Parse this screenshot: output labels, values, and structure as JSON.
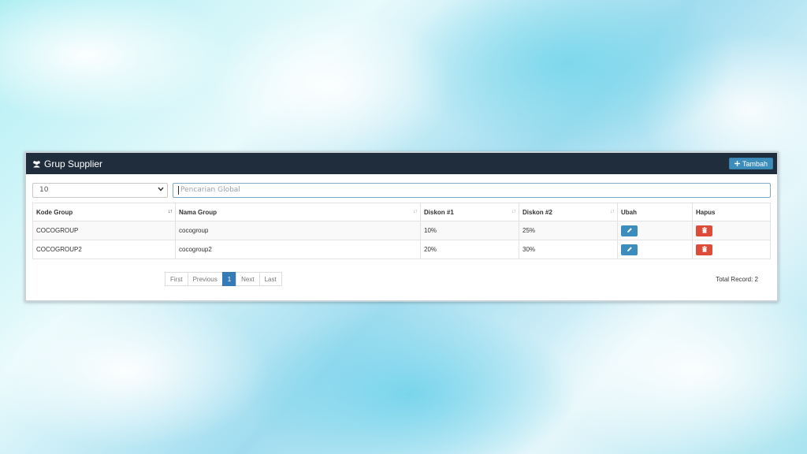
{
  "panel": {
    "title": "Grup Supplier",
    "title_icon": "group-icon",
    "add_label": "Tambah"
  },
  "toolbar": {
    "page_size": "10",
    "search_placeholder": "Pencarian Global"
  },
  "table": {
    "columns": [
      "Kode Group",
      "Nama Group",
      "Diskon #1",
      "Diskon #2",
      "Ubah",
      "Hapus"
    ],
    "rows": [
      [
        "COCOGROUP",
        "cocogroup",
        "10%",
        "25%"
      ],
      [
        "COCOGROUP2",
        "cocogroup2",
        "20%",
        "30%"
      ]
    ]
  },
  "pagination": {
    "first": "First",
    "previous": "Previous",
    "current": "1",
    "next": "Next",
    "last": "Last"
  },
  "total_record": "Total Record: 2",
  "colors": {
    "header_bg": "#1f2d3d",
    "primary": "#3c8dbc",
    "danger": "#dd4b39"
  }
}
